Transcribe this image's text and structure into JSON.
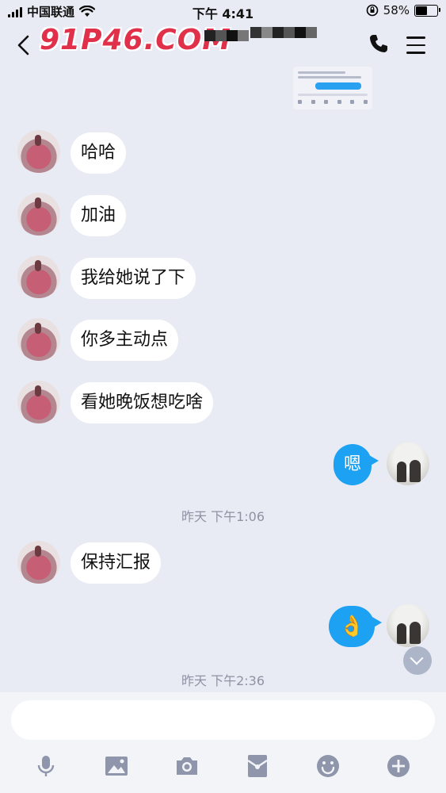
{
  "status_bar": {
    "carrier": "中国联通",
    "time": "下午 4:41",
    "battery": "58%",
    "battery_level": 0.58
  },
  "nav": {
    "title": "91P46.COM"
  },
  "messages": [
    {
      "sender": "other",
      "text": "哈哈"
    },
    {
      "sender": "other",
      "text": "加油"
    },
    {
      "sender": "other",
      "text": "我给她说了下"
    },
    {
      "sender": "other",
      "text": "你多主动点"
    },
    {
      "sender": "other",
      "text": "看她晚饭想吃啥"
    },
    {
      "sender": "me",
      "text": "嗯"
    },
    {
      "sender": "other",
      "text": "保持汇报"
    },
    {
      "sender": "me",
      "text": "👌"
    }
  ],
  "timestamps": [
    "昨天 下午1:06",
    "昨天 下午2:36"
  ],
  "input": {
    "placeholder": ""
  },
  "toolbar": [
    "mic-icon",
    "image-icon",
    "camera-icon",
    "red-packet-icon",
    "emoji-icon",
    "plus-icon"
  ],
  "colors": {
    "background": "#e9ebf4",
    "my_bubble": "#1da1f2",
    "other_bubble": "#ffffff",
    "watermark": "#e0304a"
  }
}
